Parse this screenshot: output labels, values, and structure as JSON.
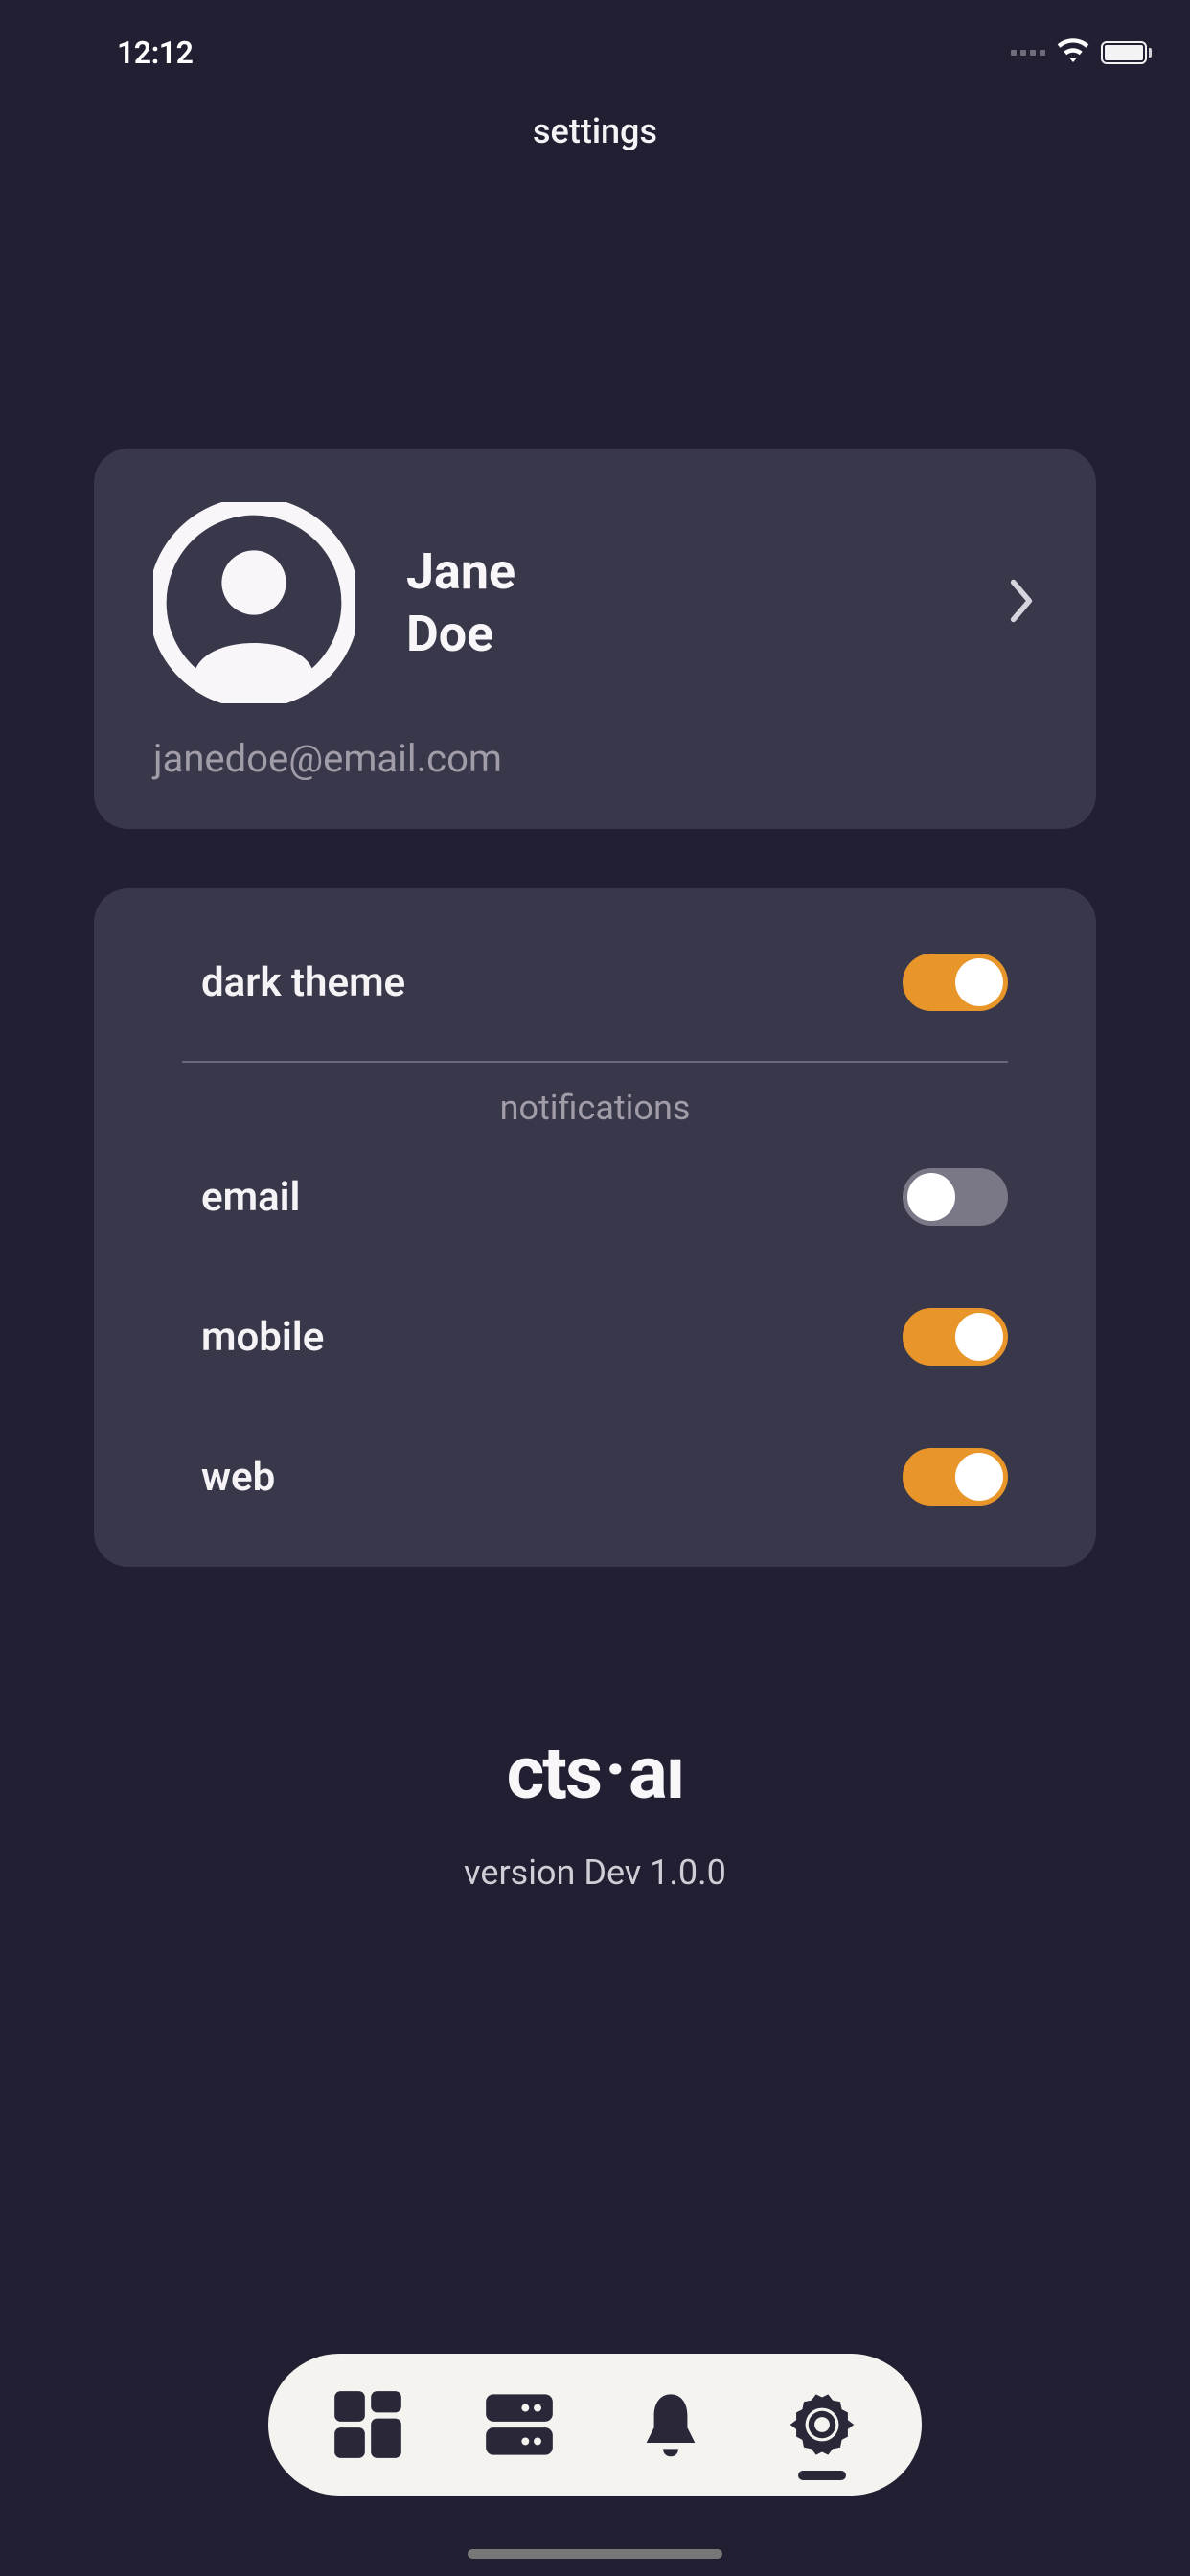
{
  "status": {
    "time": "12:12"
  },
  "header": {
    "title": "settings"
  },
  "profile": {
    "first_name": "Jane",
    "last_name": "Doe",
    "email": "janedoe@email.com"
  },
  "settings": {
    "dark_theme": {
      "label": "dark theme",
      "value": true
    },
    "notifications_title": "notifications",
    "notifications": {
      "email": {
        "label": "email",
        "value": false
      },
      "mobile": {
        "label": "mobile",
        "value": true
      },
      "web": {
        "label": "web",
        "value": true
      }
    }
  },
  "brand": {
    "name_a": "cts",
    "name_b": "aı",
    "version": "version Dev 1.0.0"
  },
  "colors": {
    "background": "#221f33",
    "card": "#39374a",
    "accent": "#e8962a",
    "toggle_off": "#7a7786",
    "muted": "#a09ca8"
  }
}
